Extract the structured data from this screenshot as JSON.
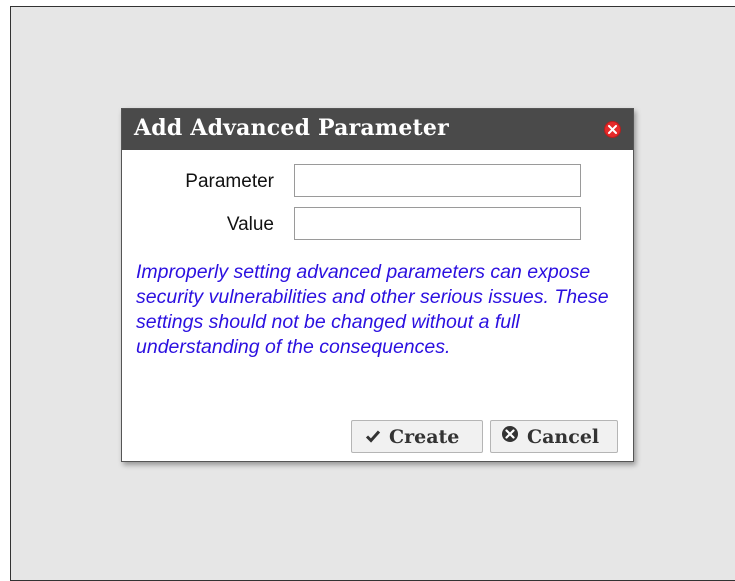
{
  "dialog": {
    "title": "Add Advanced Parameter",
    "close_icon": "close-circle-icon",
    "fields": [
      {
        "label": "Parameter",
        "value": ""
      },
      {
        "label": "Value",
        "value": ""
      }
    ],
    "warning": "Improperly setting advanced parameters can expose security vulnerabilities and other serious issues. These settings should not be changed without a full understanding of the consequences.",
    "buttons": {
      "create": {
        "label": "Create",
        "icon": "check-icon"
      },
      "cancel": {
        "label": "Cancel",
        "icon": "cancel-circle-icon"
      }
    }
  },
  "colors": {
    "titlebar": "#4a4a4a",
    "close": "#e52a2a",
    "warning_text": "#2b10e0",
    "backdrop": "#e6e6e6"
  }
}
